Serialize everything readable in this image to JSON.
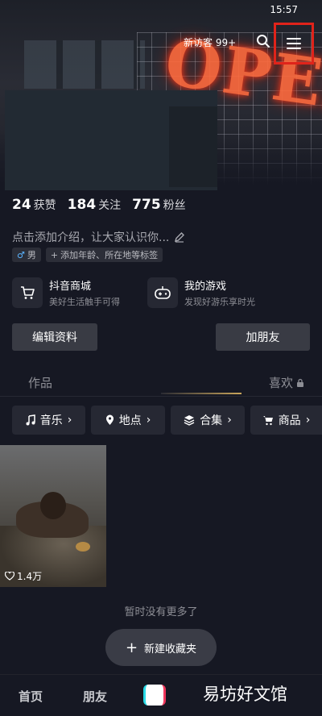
{
  "status": {
    "time": "15:57"
  },
  "top_bar": {
    "label": "新访客 99+"
  },
  "stats": [
    {
      "value": "24",
      "label": "获赞"
    },
    {
      "value": "184",
      "label": "关注"
    },
    {
      "value": "775",
      "label": "粉丝"
    }
  ],
  "intro": {
    "text": "点击添加介绍，让大家认识你..."
  },
  "tags": {
    "gender": "男",
    "gender_symbol": "♂",
    "add": "添加年龄、所在地等标签"
  },
  "services": [
    {
      "title": "抖音商城",
      "subtitle": "美好生活触手可得",
      "icon": "cart-icon"
    },
    {
      "title": "我的游戏",
      "subtitle": "发现好游乐享时光",
      "icon": "gamepad-icon"
    }
  ],
  "buttons": {
    "edit_profile": "编辑资料",
    "add_friend": "加朋友"
  },
  "tabs": {
    "works": "作品",
    "likes": "喜欢"
  },
  "filters": [
    {
      "label": "音乐",
      "icon": "music-icon"
    },
    {
      "label": "地点",
      "icon": "location-icon"
    },
    {
      "label": "合集",
      "icon": "layers-icon"
    },
    {
      "label": "商品",
      "icon": "cart-icon"
    }
  ],
  "video": {
    "likes": "1.4万"
  },
  "no_more": "暂时没有更多了",
  "new_folder": "新建收藏夹",
  "bottom_nav": {
    "home": "首页",
    "friends": "朋友"
  },
  "watermark": "易坊好文馆",
  "colors": {
    "background": "#161823",
    "accent_neon": "#ff6a3d",
    "highlight_box": "#e0231a"
  }
}
